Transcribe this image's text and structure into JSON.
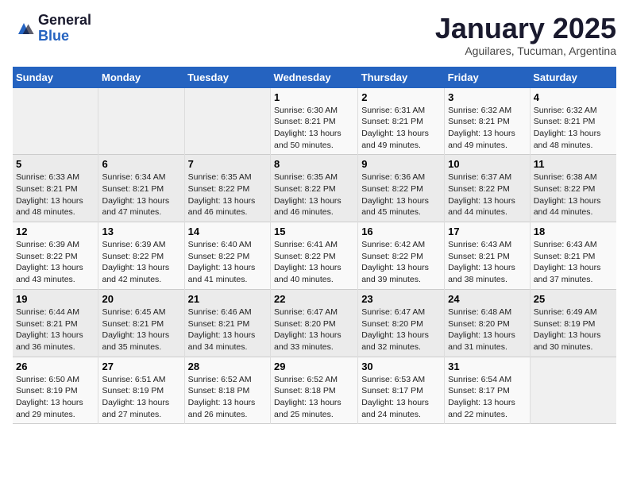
{
  "logo": {
    "general": "General",
    "blue": "Blue"
  },
  "header": {
    "month": "January 2025",
    "location": "Aguilares, Tucuman, Argentina"
  },
  "days_of_week": [
    "Sunday",
    "Monday",
    "Tuesday",
    "Wednesday",
    "Thursday",
    "Friday",
    "Saturday"
  ],
  "weeks": [
    [
      {
        "day": "",
        "info": ""
      },
      {
        "day": "",
        "info": ""
      },
      {
        "day": "",
        "info": ""
      },
      {
        "day": "1",
        "info": "Sunrise: 6:30 AM\nSunset: 8:21 PM\nDaylight: 13 hours\nand 50 minutes."
      },
      {
        "day": "2",
        "info": "Sunrise: 6:31 AM\nSunset: 8:21 PM\nDaylight: 13 hours\nand 49 minutes."
      },
      {
        "day": "3",
        "info": "Sunrise: 6:32 AM\nSunset: 8:21 PM\nDaylight: 13 hours\nand 49 minutes."
      },
      {
        "day": "4",
        "info": "Sunrise: 6:32 AM\nSunset: 8:21 PM\nDaylight: 13 hours\nand 48 minutes."
      }
    ],
    [
      {
        "day": "5",
        "info": "Sunrise: 6:33 AM\nSunset: 8:21 PM\nDaylight: 13 hours\nand 48 minutes."
      },
      {
        "day": "6",
        "info": "Sunrise: 6:34 AM\nSunset: 8:21 PM\nDaylight: 13 hours\nand 47 minutes."
      },
      {
        "day": "7",
        "info": "Sunrise: 6:35 AM\nSunset: 8:22 PM\nDaylight: 13 hours\nand 46 minutes."
      },
      {
        "day": "8",
        "info": "Sunrise: 6:35 AM\nSunset: 8:22 PM\nDaylight: 13 hours\nand 46 minutes."
      },
      {
        "day": "9",
        "info": "Sunrise: 6:36 AM\nSunset: 8:22 PM\nDaylight: 13 hours\nand 45 minutes."
      },
      {
        "day": "10",
        "info": "Sunrise: 6:37 AM\nSunset: 8:22 PM\nDaylight: 13 hours\nand 44 minutes."
      },
      {
        "day": "11",
        "info": "Sunrise: 6:38 AM\nSunset: 8:22 PM\nDaylight: 13 hours\nand 44 minutes."
      }
    ],
    [
      {
        "day": "12",
        "info": "Sunrise: 6:39 AM\nSunset: 8:22 PM\nDaylight: 13 hours\nand 43 minutes."
      },
      {
        "day": "13",
        "info": "Sunrise: 6:39 AM\nSunset: 8:22 PM\nDaylight: 13 hours\nand 42 minutes."
      },
      {
        "day": "14",
        "info": "Sunrise: 6:40 AM\nSunset: 8:22 PM\nDaylight: 13 hours\nand 41 minutes."
      },
      {
        "day": "15",
        "info": "Sunrise: 6:41 AM\nSunset: 8:22 PM\nDaylight: 13 hours\nand 40 minutes."
      },
      {
        "day": "16",
        "info": "Sunrise: 6:42 AM\nSunset: 8:22 PM\nDaylight: 13 hours\nand 39 minutes."
      },
      {
        "day": "17",
        "info": "Sunrise: 6:43 AM\nSunset: 8:21 PM\nDaylight: 13 hours\nand 38 minutes."
      },
      {
        "day": "18",
        "info": "Sunrise: 6:43 AM\nSunset: 8:21 PM\nDaylight: 13 hours\nand 37 minutes."
      }
    ],
    [
      {
        "day": "19",
        "info": "Sunrise: 6:44 AM\nSunset: 8:21 PM\nDaylight: 13 hours\nand 36 minutes."
      },
      {
        "day": "20",
        "info": "Sunrise: 6:45 AM\nSunset: 8:21 PM\nDaylight: 13 hours\nand 35 minutes."
      },
      {
        "day": "21",
        "info": "Sunrise: 6:46 AM\nSunset: 8:21 PM\nDaylight: 13 hours\nand 34 minutes."
      },
      {
        "day": "22",
        "info": "Sunrise: 6:47 AM\nSunset: 8:20 PM\nDaylight: 13 hours\nand 33 minutes."
      },
      {
        "day": "23",
        "info": "Sunrise: 6:47 AM\nSunset: 8:20 PM\nDaylight: 13 hours\nand 32 minutes."
      },
      {
        "day": "24",
        "info": "Sunrise: 6:48 AM\nSunset: 8:20 PM\nDaylight: 13 hours\nand 31 minutes."
      },
      {
        "day": "25",
        "info": "Sunrise: 6:49 AM\nSunset: 8:19 PM\nDaylight: 13 hours\nand 30 minutes."
      }
    ],
    [
      {
        "day": "26",
        "info": "Sunrise: 6:50 AM\nSunset: 8:19 PM\nDaylight: 13 hours\nand 29 minutes."
      },
      {
        "day": "27",
        "info": "Sunrise: 6:51 AM\nSunset: 8:19 PM\nDaylight: 13 hours\nand 27 minutes."
      },
      {
        "day": "28",
        "info": "Sunrise: 6:52 AM\nSunset: 8:18 PM\nDaylight: 13 hours\nand 26 minutes."
      },
      {
        "day": "29",
        "info": "Sunrise: 6:52 AM\nSunset: 8:18 PM\nDaylight: 13 hours\nand 25 minutes."
      },
      {
        "day": "30",
        "info": "Sunrise: 6:53 AM\nSunset: 8:17 PM\nDaylight: 13 hours\nand 24 minutes."
      },
      {
        "day": "31",
        "info": "Sunrise: 6:54 AM\nSunset: 8:17 PM\nDaylight: 13 hours\nand 22 minutes."
      },
      {
        "day": "",
        "info": ""
      }
    ]
  ]
}
